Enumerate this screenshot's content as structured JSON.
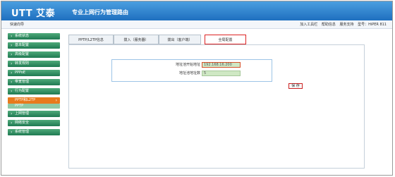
{
  "header": {
    "logo_text": "UTT 艾泰",
    "slogan": "专业上网行为管理路由"
  },
  "toolbar": {
    "quick_wizard": "快速向导",
    "links": [
      "加入工具栏",
      "帮助信息",
      "服务支持",
      "型号：HiPER 811"
    ]
  },
  "sidebar": {
    "items": [
      {
        "label": "系统状态"
      },
      {
        "label": "基本配置"
      },
      {
        "label": "高级配置"
      },
      {
        "label": "转发规则"
      },
      {
        "label": "PPPoE"
      },
      {
        "label": "带宽管理"
      },
      {
        "label": "行为配置"
      },
      {
        "label": "PPTP和L2TP",
        "active": true
      },
      {
        "label": "PPTP",
        "sub": true
      },
      {
        "label": "上网管理"
      },
      {
        "label": "网络安全"
      },
      {
        "label": "系统管理"
      }
    ]
  },
  "tabs": [
    {
      "label": "PPTP/L2TP信息"
    },
    {
      "label": "拨入（服务器）"
    },
    {
      "label": "拨出（客户端）"
    },
    {
      "label": "全局配置",
      "active": true
    }
  ],
  "form": {
    "start_label": "地址池开始地址",
    "start_value": "192.168.16.200",
    "count_label": "地址池地址数",
    "count_value": "5",
    "save_label": "保 存"
  }
}
